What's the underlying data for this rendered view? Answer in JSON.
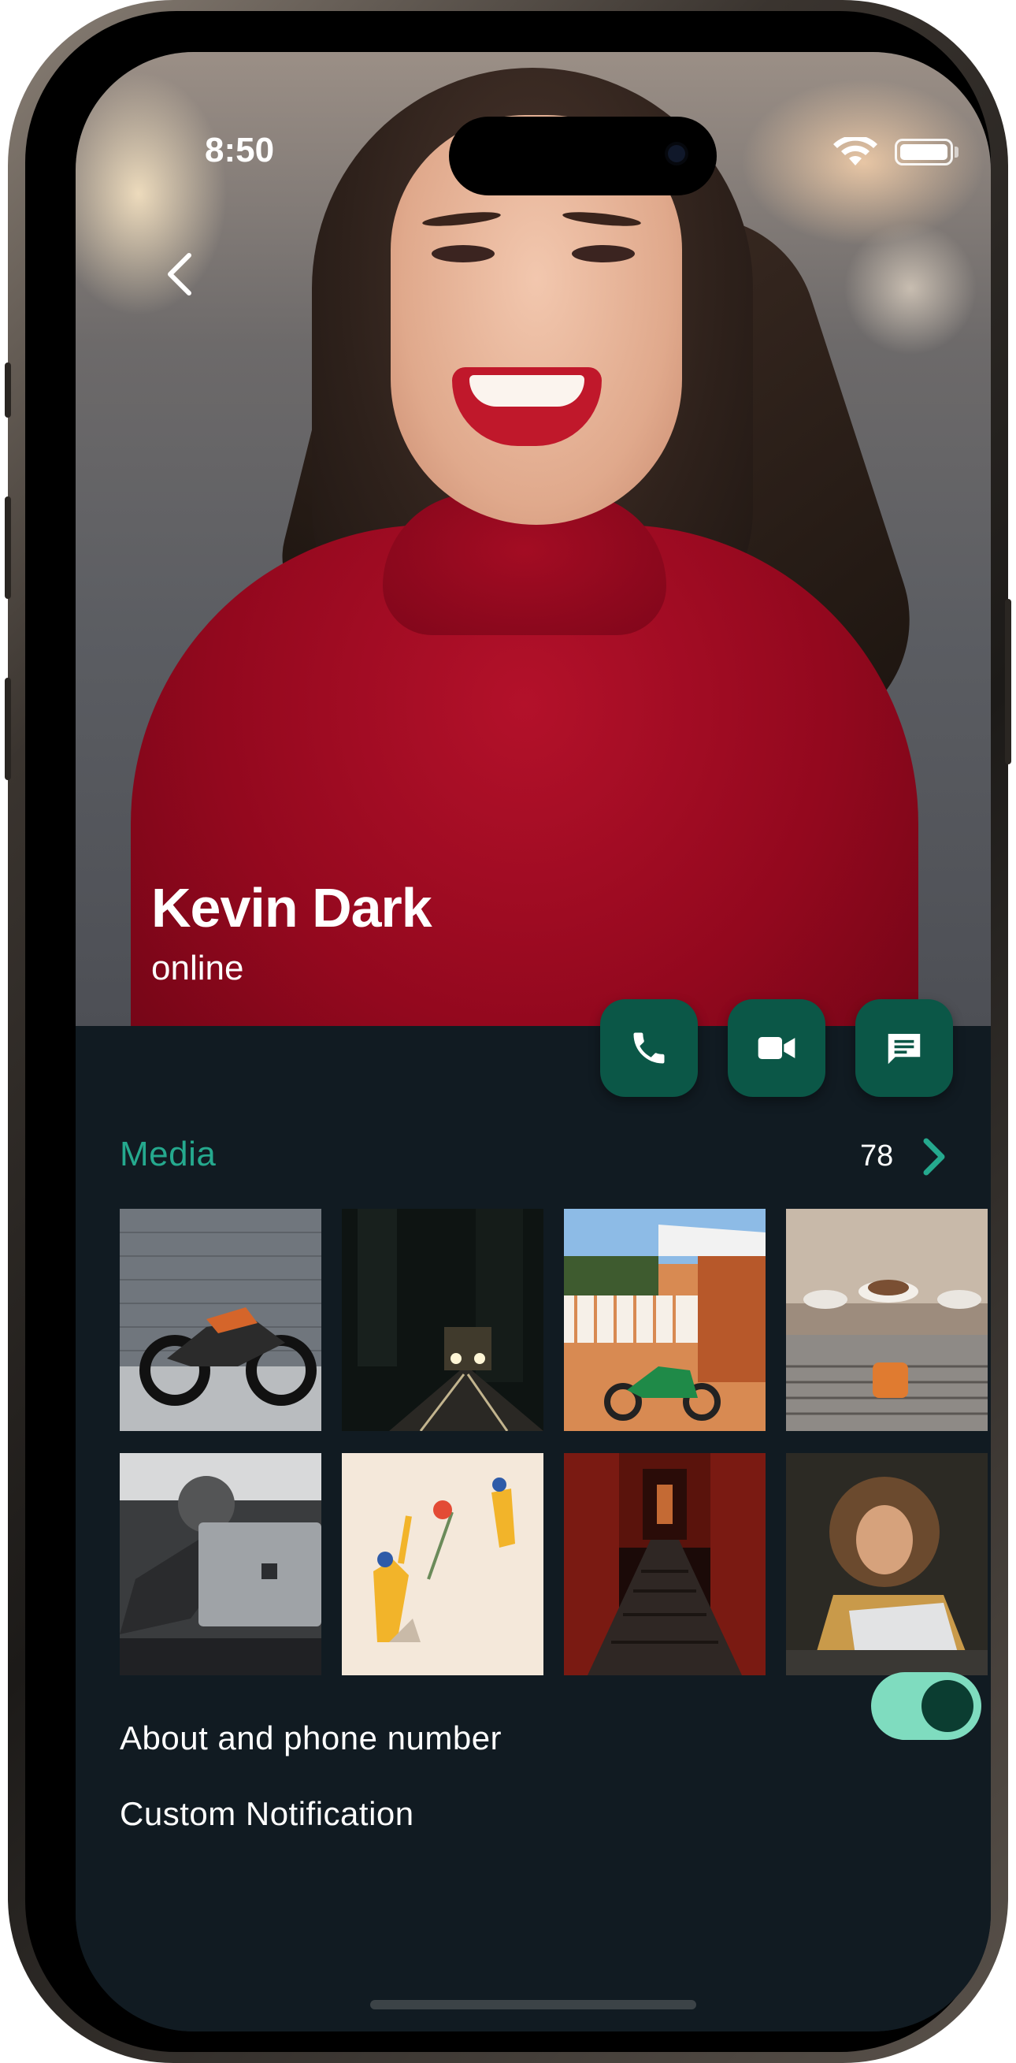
{
  "status_bar": {
    "time": "8:50"
  },
  "header": {
    "contact_name": "Kevin Dark",
    "presence": "online"
  },
  "actions": [
    {
      "name": "call",
      "icon": "phone-icon"
    },
    {
      "name": "video",
      "icon": "video-icon"
    },
    {
      "name": "message",
      "icon": "message-icon"
    }
  ],
  "media": {
    "label": "Media",
    "count": "78",
    "items": [
      {
        "description": "motorcycle-photo"
      },
      {
        "description": "night-train-photo"
      },
      {
        "description": "scooter-house-photo"
      },
      {
        "description": "coffee-machine-photo"
      },
      {
        "description": "laptop-person-photo"
      },
      {
        "description": "illustration-figures"
      },
      {
        "description": "torii-gates-photo"
      },
      {
        "description": "smiling-woman-photo"
      }
    ]
  },
  "settings": {
    "about_label": "About and phone number",
    "about_toggle_on": true,
    "notification_label": "Custom Notification"
  },
  "colors": {
    "accent": "#25a98e",
    "action_button": "#0b5747",
    "panel_bg": "#111b22",
    "toggle_track": "#7fdcbf"
  }
}
